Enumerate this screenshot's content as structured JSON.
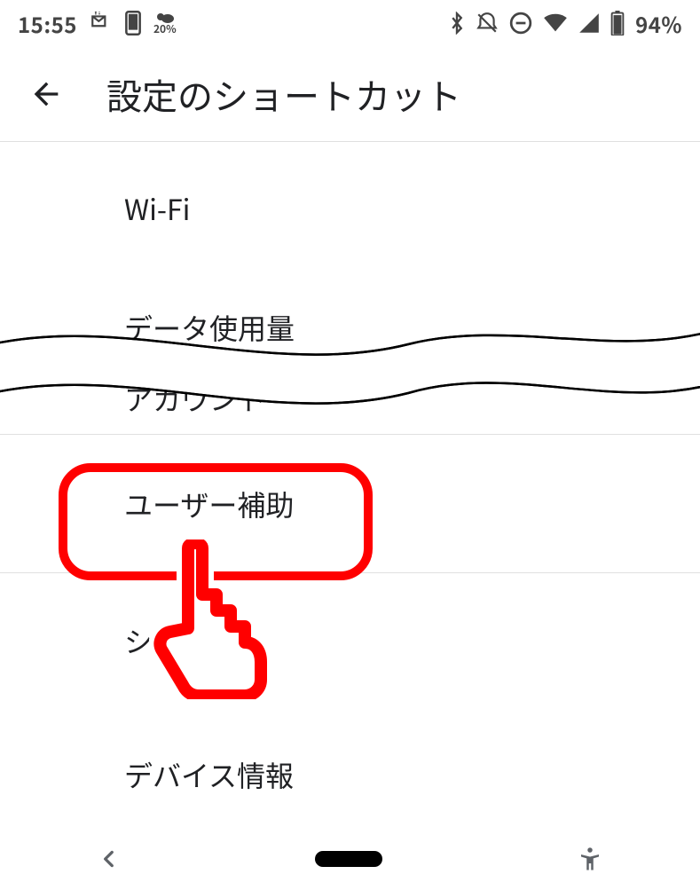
{
  "statusbar": {
    "time": "15:55",
    "weather_pct": "20%",
    "battery_pct": "94%"
  },
  "appbar": {
    "title": "設定のショートカット"
  },
  "list": {
    "items": [
      {
        "label": "Wi-Fi"
      },
      {
        "label": "データ使用量"
      },
      {
        "label": "アカウント"
      },
      {
        "label": "ユーザー補助"
      },
      {
        "label": "システム"
      },
      {
        "label": "デバイス情報"
      }
    ]
  }
}
